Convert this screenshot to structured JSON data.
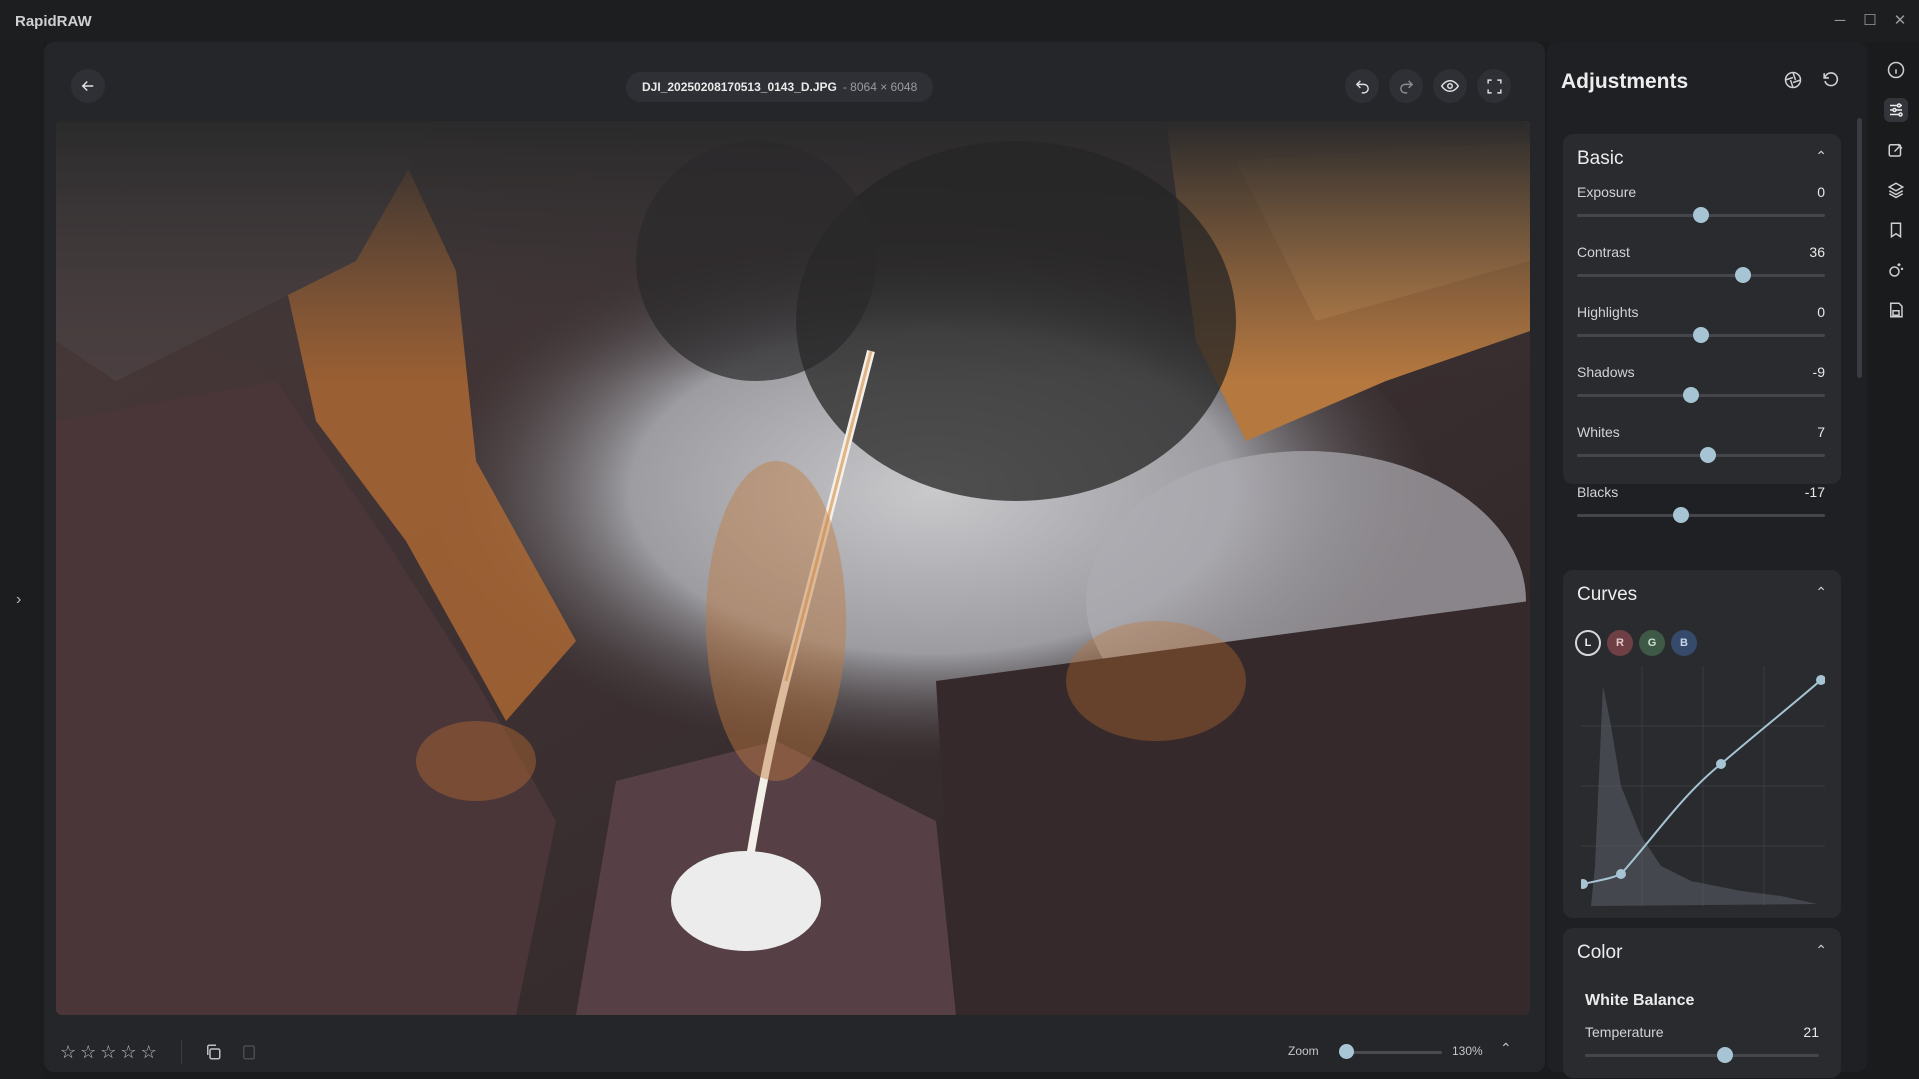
{
  "app": {
    "title": "RapidRAW"
  },
  "window_controls": {
    "minimize": "─",
    "maximize": "☐",
    "close": "✕"
  },
  "editor": {
    "file_name": "DJI_20250208170513_0143_D.JPG",
    "file_dims": "- 8064 × 6048",
    "rating_stars": [
      "☆",
      "☆",
      "☆",
      "☆",
      "☆"
    ],
    "zoom_label": "Zoom",
    "zoom_value": "130%",
    "zoom_fraction": 0.04
  },
  "adjustments": {
    "title": "Adjustments",
    "basic": {
      "title": "Basic",
      "sliders": [
        {
          "label": "Exposure",
          "value": "0",
          "fraction": 0.5
        },
        {
          "label": "Contrast",
          "value": "36",
          "fraction": 0.67
        },
        {
          "label": "Highlights",
          "value": "0",
          "fraction": 0.5
        },
        {
          "label": "Shadows",
          "value": "-9",
          "fraction": 0.46
        },
        {
          "label": "Whites",
          "value": "7",
          "fraction": 0.53
        },
        {
          "label": "Blacks",
          "value": "-17",
          "fraction": 0.42
        }
      ]
    },
    "curves": {
      "title": "Curves",
      "channels": [
        {
          "label": "L",
          "color": "#2f3034"
        },
        {
          "label": "R",
          "color": "#6e3f44"
        },
        {
          "label": "G",
          "color": "#3e5a46"
        },
        {
          "label": "B",
          "color": "#364a6b"
        }
      ]
    },
    "color": {
      "title": "Color",
      "white_balance_title": "White Balance",
      "temperature": {
        "label": "Temperature",
        "value": "21",
        "fraction": 0.6
      }
    }
  },
  "colors": {
    "accent": "#a6c4d4",
    "panel": "#1f2023",
    "card": "#2a2b2f"
  }
}
